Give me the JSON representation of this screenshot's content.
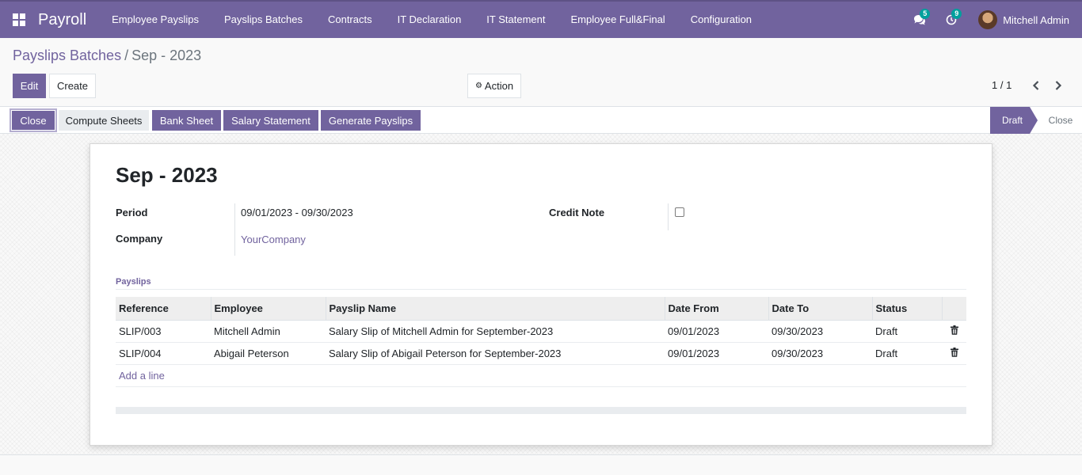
{
  "navbar": {
    "app_name": "Payroll",
    "menu": [
      "Employee Payslips",
      "Payslips Batches",
      "Contracts",
      "IT Declaration",
      "IT Statement",
      "Employee Full&Final",
      "Configuration"
    ],
    "messages_count": "5",
    "activities_count": "9",
    "user_name": "Mitchell Admin",
    "accent_color": "#71639e"
  },
  "breadcrumb": {
    "parent": "Payslips Batches",
    "separator": "/",
    "current": "Sep - 2023"
  },
  "control": {
    "edit_label": "Edit",
    "create_label": "Create",
    "action_label": "Action",
    "pager": "1 / 1"
  },
  "statusbar": {
    "buttons": [
      "Close",
      "Compute Sheets",
      "Bank Sheet",
      "Salary Statement",
      "Generate Payslips"
    ],
    "stages": [
      "Draft",
      "Close"
    ],
    "active_stage": "Draft"
  },
  "record": {
    "title": "Sep - 2023",
    "period_label": "Period",
    "period_value": "09/01/2023 - 09/30/2023",
    "company_label": "Company",
    "company_value": "YourCompany",
    "credit_note_label": "Credit Note",
    "credit_note_checked": false,
    "payslips_section": "Payslips",
    "columns": [
      "Reference",
      "Employee",
      "Payslip Name",
      "Date From",
      "Date To",
      "Status"
    ],
    "rows": [
      {
        "reference": "SLIP/003",
        "employee": "Mitchell Admin",
        "name": "Salary Slip of Mitchell Admin for September-2023",
        "date_from": "09/01/2023",
        "date_to": "09/30/2023",
        "status": "Draft"
      },
      {
        "reference": "SLIP/004",
        "employee": "Abigail Peterson",
        "name": "Salary Slip of Abigail Peterson for September-2023",
        "date_from": "09/01/2023",
        "date_to": "09/30/2023",
        "status": "Draft"
      }
    ],
    "add_line_label": "Add a line"
  }
}
